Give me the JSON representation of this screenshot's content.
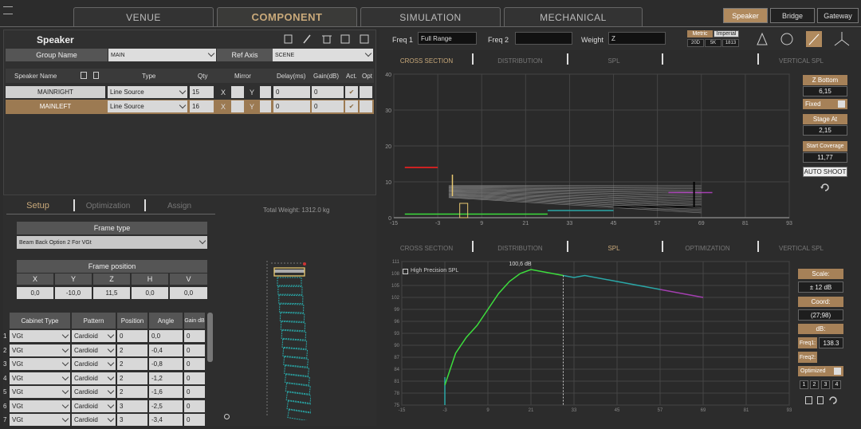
{
  "main_tabs": [
    {
      "label": "VENUE"
    },
    {
      "label": "COMPONENT"
    },
    {
      "label": "SIMULATION"
    },
    {
      "label": "MECHANICAL"
    }
  ],
  "right_tabs": [
    {
      "label": "Speaker"
    },
    {
      "label": "Bridge"
    },
    {
      "label": "Gateway"
    }
  ],
  "speaker_panel": {
    "title": "Speaker",
    "group_name_label": "Group Name",
    "group_name_value": "MAIN",
    "ref_axis_label": "Ref Axis",
    "ref_axis_value": "SCENE"
  },
  "speaker_table": {
    "headers": [
      "Speaker Name",
      "Type",
      "Qty",
      "Mirror",
      "Delay(ms)",
      "Gain(dB)",
      "Act.",
      "Opt"
    ],
    "rows": [
      {
        "name": "MAINRIGHT",
        "type": "Line Source",
        "qty": "15",
        "x": "X",
        "y": "Y",
        "delay": "0",
        "gain": "0"
      },
      {
        "name": "MAINLEFT",
        "type": "Line Source",
        "qty": "16",
        "x": "X",
        "y": "Y",
        "delay": "0",
        "gain": "0"
      }
    ]
  },
  "lower_tabs": [
    "Setup",
    "Optimization",
    "Assign"
  ],
  "total_weight": "Total Weight: 1312.0 kg",
  "frame_type": {
    "label": "Frame type",
    "value": "Beam Back Option 2 For VGt"
  },
  "frame_position": {
    "label": "Frame position",
    "headers": [
      "X",
      "Y",
      "Z",
      "H",
      "V"
    ],
    "values": [
      "0,0",
      "-10,0",
      "11,5",
      "0,0",
      "0,0"
    ]
  },
  "cabinet_table": {
    "headers": [
      "Cabinet Type",
      "Pattern",
      "Position",
      "Angle",
      "Gain dB"
    ],
    "rows": [
      {
        "n": "1",
        "type": "VGt",
        "pattern": "Cardioid",
        "pos": "0",
        "angle": "0,0",
        "gain": "0"
      },
      {
        "n": "2",
        "type": "VGt",
        "pattern": "Cardioid",
        "pos": "2",
        "angle": "-0,4",
        "gain": "0"
      },
      {
        "n": "3",
        "type": "VGt",
        "pattern": "Cardioid",
        "pos": "2",
        "angle": "-0,8",
        "gain": "0"
      },
      {
        "n": "4",
        "type": "VGt",
        "pattern": "Cardioid",
        "pos": "2",
        "angle": "-1,2",
        "gain": "0"
      },
      {
        "n": "5",
        "type": "VGt",
        "pattern": "Cardioid",
        "pos": "2",
        "angle": "-1,6",
        "gain": "0"
      },
      {
        "n": "6",
        "type": "VGt",
        "pattern": "Cardioid",
        "pos": "3",
        "angle": "-2,5",
        "gain": "0"
      },
      {
        "n": "7",
        "type": "VGt",
        "pattern": "Cardioid",
        "pos": "3",
        "angle": "-3,4",
        "gain": "0"
      }
    ]
  },
  "sim_toolbar": {
    "freq1_label": "Freq 1",
    "freq1_value": "Full Range",
    "freq2_label": "Freq 2",
    "freq2_value": "",
    "weight_label": "Weight",
    "weight_value": "Z",
    "metric": "Metric",
    "imperial": "Imperial",
    "d1": "20D",
    "d2": "5K",
    "d3": "1813"
  },
  "view_tabs_top": [
    "CROSS SECTION",
    "DISTRIBUTION",
    "SPL",
    "",
    "VERTICAL SPL"
  ],
  "view_tabs_bottom": [
    "CROSS SECTION",
    "DISTRIBUTION",
    "SPL",
    "OPTIMIZATION",
    "VERTICAL SPL"
  ],
  "cross_section": {
    "y_ticks": [
      "40",
      "30",
      "20",
      "10",
      "0"
    ],
    "x_ticks": [
      "-15",
      "-3",
      "9",
      "21",
      "33",
      "45",
      "57",
      "69",
      "81",
      "93"
    ]
  },
  "right_controls_top": {
    "z_bottom_label": "Z Bottom",
    "z_bottom_value": "6,15",
    "fixed_label": "Fixed",
    "stage_at_label": "Stage At",
    "stage_at_value": "2,15",
    "start_cov_label": "Start Coverage",
    "start_cov_value": "11,77",
    "auto_shoot": "AUTO SHOOT"
  },
  "spl_chart": {
    "high_precision": "High Precision SPL",
    "peak_label": "100,6 dB",
    "y_ticks": [
      "111",
      "108",
      "105",
      "102",
      "99",
      "96",
      "93",
      "90",
      "87",
      "84",
      "81",
      "78",
      "75"
    ],
    "x_ticks": [
      "-15",
      "-3",
      "9",
      "21",
      "33",
      "45",
      "57",
      "69",
      "81",
      "93"
    ]
  },
  "right_controls_bottom": {
    "scale_label": "Scale:",
    "scale_value": "± 12 dB",
    "coord_label": "Coord:",
    "coord_value": "(27;98)",
    "db_label": "dB:",
    "freq1_label": "Freq1:",
    "freq1_value": "138.3",
    "freq2_label": "Freq2:",
    "optimized_label": "Optimized",
    "nums": [
      "1",
      "2",
      "3",
      "4"
    ]
  },
  "colors": {
    "accent": "#b08a5e",
    "green": "#3ddc3d",
    "cyan": "#2aa7a7",
    "magenta": "#a33fb0"
  },
  "chart_data": [
    {
      "type": "line",
      "title": "",
      "xlabel": "",
      "ylabel": "",
      "ylim": [
        0,
        40
      ],
      "xlim": [
        -15,
        93
      ],
      "series": [
        {
          "name": "",
          "x": [
            -3,
            9,
            21,
            33,
            45,
            57,
            69
          ],
          "y": [
            8,
            7,
            6,
            5,
            4,
            3,
            2
          ]
        }
      ]
    },
    {
      "type": "line",
      "title": "",
      "ylim": [
        75,
        111
      ],
      "xlim": [
        -15,
        93
      ],
      "series": [
        {
          "name": "",
          "x": [
            -3,
            0,
            3,
            6,
            9,
            12,
            15,
            18,
            21,
            24,
            27,
            30,
            33,
            36,
            45,
            57,
            63,
            69
          ],
          "y": [
            80,
            88,
            92,
            95,
            99,
            103,
            106,
            108,
            109,
            108.5,
            108,
            107.5,
            107,
            107.5,
            106,
            104,
            103,
            102
          ]
        }
      ]
    }
  ]
}
